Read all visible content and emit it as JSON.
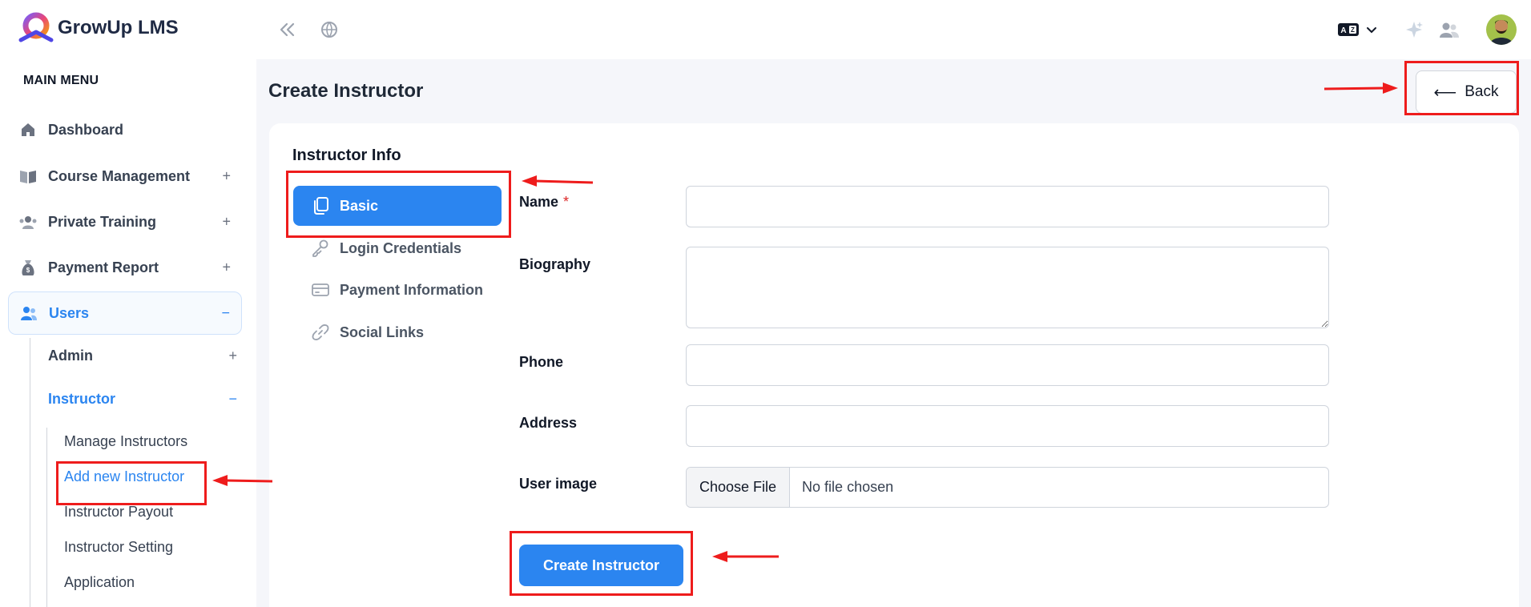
{
  "app": {
    "name": "GrowUp LMS"
  },
  "sidebar": {
    "menu_title": "MAIN MENU",
    "items": [
      {
        "label": "Dashboard",
        "toggle": ""
      },
      {
        "label": "Course Management",
        "toggle": "+"
      },
      {
        "label": "Private Training",
        "toggle": "+"
      },
      {
        "label": "Payment Report",
        "toggle": "+"
      },
      {
        "label": "Users",
        "toggle": "−"
      }
    ],
    "users_children": [
      {
        "label": "Admin",
        "toggle": "+"
      },
      {
        "label": "Instructor",
        "toggle": "−"
      }
    ],
    "instructor_children": [
      {
        "label": "Manage Instructors"
      },
      {
        "label": "Add new Instructor"
      },
      {
        "label": "Instructor Payout"
      },
      {
        "label": "Instructor Setting"
      },
      {
        "label": "Application"
      }
    ]
  },
  "topbar": {
    "icons": [
      "collapse-icon",
      "globe-icon",
      "language-icon",
      "sparkle-icon",
      "users-icon",
      "avatar"
    ]
  },
  "page": {
    "title": "Create Instructor",
    "back_label": "Back",
    "back_arrow": "⟵"
  },
  "form": {
    "section_title": "Instructor Info",
    "tabs": [
      {
        "label": "Basic",
        "icon": "copy-icon",
        "active": true
      },
      {
        "label": "Login Credentials",
        "icon": "key-icon",
        "active": false
      },
      {
        "label": "Payment Information",
        "icon": "credit-card-icon",
        "active": false
      },
      {
        "label": "Social Links",
        "icon": "link-icon",
        "active": false
      }
    ],
    "fields": {
      "name": {
        "label": "Name",
        "required_mark": "*",
        "value": ""
      },
      "biography": {
        "label": "Biography",
        "value": ""
      },
      "phone": {
        "label": "Phone",
        "value": ""
      },
      "address": {
        "label": "Address",
        "value": ""
      },
      "user_image": {
        "label": "User image",
        "button": "Choose File",
        "status": "No file chosen"
      }
    },
    "submit_label": "Create Instructor"
  },
  "colors": {
    "accent": "#2b85f0",
    "annotation": "#ee1c1c",
    "required": "#dc2626"
  }
}
